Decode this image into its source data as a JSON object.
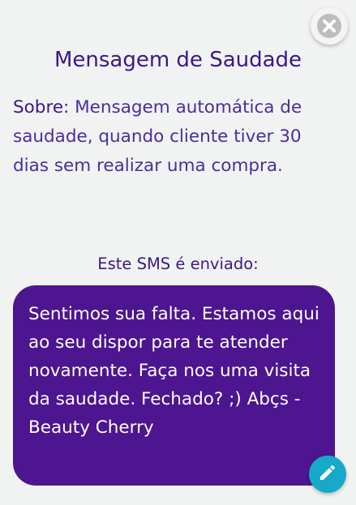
{
  "dialog": {
    "title": "Mensagem de Saudade",
    "close_icon": "close-icon",
    "about_label": "Sobre:",
    "about_text": " Mensagem automática de saudade, quando cliente tiver 30 dias sem realizar uma compra.",
    "sent_label": "Este SMS é enviado:",
    "sms_text": "Sentimos sua falta. Estamos aqui ao seu dispor para te atender novamente. Faça nos uma visita da saudade. Fechado? ;) Abçs - Beauty Cherry",
    "edit_icon": "pencil-icon"
  },
  "colors": {
    "title": "#3d168a",
    "body_text": "#4c2c9e",
    "bubble": "#4d1590",
    "edit_button": "#16a9c9",
    "close_button": "#bdbdbd",
    "background": "#f1f3f3"
  }
}
